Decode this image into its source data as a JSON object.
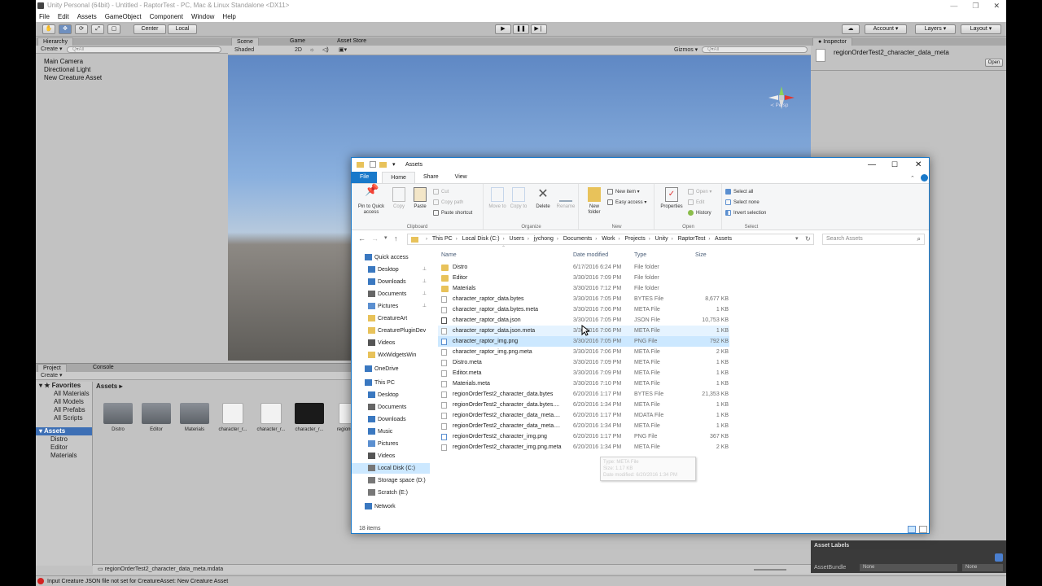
{
  "unity": {
    "title": "Unity Personal (64bit) - Untitled - RaptorTest - PC, Mac & Linux Standalone <DX11>",
    "menu": [
      "File",
      "Edit",
      "Assets",
      "GameObject",
      "Component",
      "Window",
      "Help"
    ],
    "toolbar": {
      "center": "Center",
      "local": "Local",
      "account": "Account",
      "layers": "Layers",
      "layout": "Layout"
    },
    "hierarchy": {
      "tab": "Hierarchy",
      "create": "Create",
      "search_placeholder": "Q▾All",
      "items": [
        "Main Camera",
        "Directional Light",
        "New Creature Asset"
      ]
    },
    "scene": {
      "tabs": [
        "Scene",
        "Game",
        "Asset Store"
      ],
      "shading": "Shaded",
      "mode_2d": "2D",
      "gizmos": "Gizmos",
      "search_placeholder": "Q▾All",
      "persp": "≺ Persp"
    },
    "project": {
      "tabs": [
        "Project",
        "Console"
      ],
      "create": "Create",
      "favorites_label": "Favorites",
      "favorites": [
        "All Materials",
        "All Models",
        "All Prefabs",
        "All Scripts"
      ],
      "assets_label": "Assets",
      "asset_folders": [
        "Distro",
        "Editor",
        "Materials"
      ],
      "breadcrumb": "Assets ▸",
      "thumbs": [
        "Distro",
        "Editor",
        "Materials",
        "character_r...",
        "character_r...",
        "character_r...",
        "regionO..."
      ],
      "selected_file": "regionOrderTest2_character_data_meta.mdata"
    },
    "inspector": {
      "tab": "Inspector",
      "asset_name": "regionOrderTest2_character_data_meta",
      "open": "Open"
    },
    "asset_labels": {
      "title": "Asset Labels",
      "bundle_label": "AssetBundle",
      "none1": "None",
      "none2": "None"
    },
    "error": "Input Creature JSON file not set for CreatureAsset: New Creature Asset"
  },
  "explorer": {
    "title": "Assets",
    "ribbon_tabs": [
      "File",
      "Home",
      "Share",
      "View"
    ],
    "clipboard": {
      "pin": "Pin to Quick access",
      "copy": "Copy",
      "paste": "Paste",
      "cut": "Cut",
      "copy_path": "Copy path",
      "paste_shortcut": "Paste shortcut",
      "label": "Clipboard"
    },
    "organize": {
      "move_to": "Move to",
      "copy_to": "Copy to",
      "delete": "Delete",
      "rename": "Rename",
      "label": "Organize"
    },
    "new": {
      "new_folder": "New folder",
      "new_item": "New item ▾",
      "easy_access": "Easy access ▾",
      "label": "New"
    },
    "open": {
      "properties": "Properties",
      "open": "Open ▾",
      "edit": "Edit",
      "history": "History",
      "label": "Open"
    },
    "select": {
      "select_all": "Select all",
      "select_none": "Select none",
      "invert": "Invert selection",
      "label": "Select"
    },
    "breadcrumb": [
      "This PC",
      "Local Disk (C:)",
      "Users",
      "jychong",
      "Documents",
      "Work",
      "Projects",
      "Unity",
      "RaptorTest",
      "Assets"
    ],
    "search_placeholder": "Search Assets",
    "nav": [
      {
        "label": "Quick access",
        "kind": "star"
      },
      {
        "label": "Desktop",
        "kind": "desk",
        "pin": true
      },
      {
        "label": "Downloads",
        "kind": "down",
        "pin": true
      },
      {
        "label": "Documents",
        "kind": "docs",
        "pin": true
      },
      {
        "label": "Pictures",
        "kind": "pics",
        "pin": true
      },
      {
        "label": "CreatureArt",
        "kind": "folder"
      },
      {
        "label": "CreaturePluginDev",
        "kind": "folder"
      },
      {
        "label": "Videos",
        "kind": "vid"
      },
      {
        "label": "WxWidgetsWin",
        "kind": "folder"
      },
      {
        "label": "OneDrive",
        "kind": "cloud"
      },
      {
        "label": "This PC",
        "kind": "pc"
      },
      {
        "label": "Desktop",
        "kind": "desk"
      },
      {
        "label": "Documents",
        "kind": "docs"
      },
      {
        "label": "Downloads",
        "kind": "down"
      },
      {
        "label": "Music",
        "kind": "music"
      },
      {
        "label": "Pictures",
        "kind": "pics"
      },
      {
        "label": "Videos",
        "kind": "vid"
      },
      {
        "label": "Local Disk (C:)",
        "kind": "disk",
        "selected": true
      },
      {
        "label": "Storage space (D:)",
        "kind": "disk"
      },
      {
        "label": "Scratch (E:)",
        "kind": "disk"
      },
      {
        "label": "Network",
        "kind": "net"
      }
    ],
    "columns": {
      "name": "Name",
      "date": "Date modified",
      "type": "Type",
      "size": "Size"
    },
    "files": [
      {
        "name": "Distro",
        "date": "6/17/2016 6:24 PM",
        "type": "File folder",
        "size": "",
        "icon": "folder"
      },
      {
        "name": "Editor",
        "date": "3/30/2016 7:09 PM",
        "type": "File folder",
        "size": "",
        "icon": "folder"
      },
      {
        "name": "Materials",
        "date": "3/30/2016 7:12 PM",
        "type": "File folder",
        "size": "",
        "icon": "folder"
      },
      {
        "name": "character_raptor_data.bytes",
        "date": "3/30/2016 7:05 PM",
        "type": "BYTES File",
        "size": "8,677 KB",
        "icon": "file"
      },
      {
        "name": "character_raptor_data.bytes.meta",
        "date": "3/30/2016 7:06 PM",
        "type": "META File",
        "size": "1 KB",
        "icon": "file"
      },
      {
        "name": "character_raptor_data.json",
        "date": "3/30/2016 7:05 PM",
        "type": "JSON File",
        "size": "10,753 KB",
        "icon": "json"
      },
      {
        "name": "character_raptor_data.json.meta",
        "date": "3/30/2016 7:06 PM",
        "type": "META File",
        "size": "1 KB",
        "icon": "file"
      },
      {
        "name": "character_raptor_img.png",
        "date": "3/30/2016 7:05 PM",
        "type": "PNG File",
        "size": "792 KB",
        "icon": "png",
        "selected": true
      },
      {
        "name": "character_raptor_img.png.meta",
        "date": "3/30/2016 7:06 PM",
        "type": "META File",
        "size": "2 KB",
        "icon": "file"
      },
      {
        "name": "Distro.meta",
        "date": "3/30/2016 7:09 PM",
        "type": "META File",
        "size": "1 KB",
        "icon": "file"
      },
      {
        "name": "Editor.meta",
        "date": "3/30/2016 7:09 PM",
        "type": "META File",
        "size": "1 KB",
        "icon": "file"
      },
      {
        "name": "Materials.meta",
        "date": "3/30/2016 7:10 PM",
        "type": "META File",
        "size": "1 KB",
        "icon": "file"
      },
      {
        "name": "regionOrderTest2_character_data.bytes",
        "date": "6/20/2016 1:17 PM",
        "type": "BYTES File",
        "size": "21,353 KB",
        "icon": "file"
      },
      {
        "name": "regionOrderTest2_character_data.bytes....",
        "date": "6/20/2016 1:34 PM",
        "type": "META File",
        "size": "1 KB",
        "icon": "file"
      },
      {
        "name": "regionOrderTest2_character_data_meta....",
        "date": "6/20/2016 1:17 PM",
        "type": "MDATA File",
        "size": "1 KB",
        "icon": "file"
      },
      {
        "name": "regionOrderTest2_character_data_meta....",
        "date": "6/20/2016 1:34 PM",
        "type": "META File",
        "size": "1 KB",
        "icon": "file"
      },
      {
        "name": "regionOrderTest2_character_img.png",
        "date": "6/20/2016 1:17 PM",
        "type": "PNG File",
        "size": "367 KB",
        "icon": "png"
      },
      {
        "name": "regionOrderTest2_character_img.png.meta",
        "date": "6/20/2016 1:34 PM",
        "type": "META File",
        "size": "2 KB",
        "icon": "file"
      }
    ],
    "tooltip": [
      "Type: META File",
      "Size: 1.17 KB",
      "Date modified: 6/20/2016 1:34 PM"
    ],
    "status": "18 items"
  }
}
